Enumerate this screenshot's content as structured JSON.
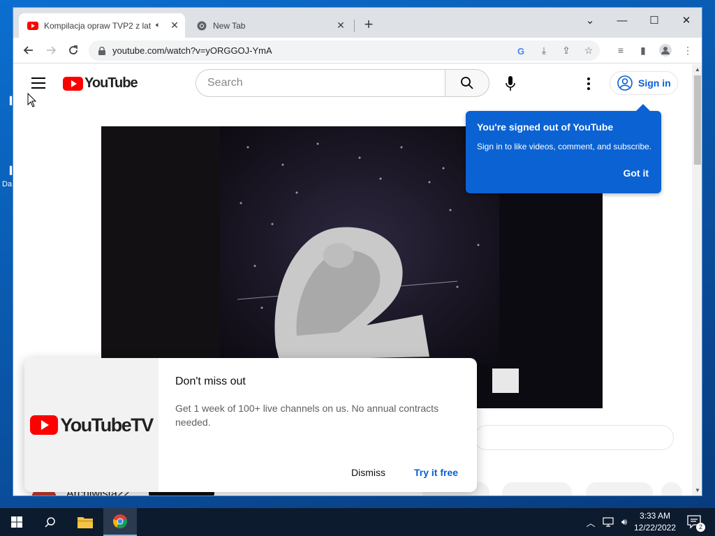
{
  "browser": {
    "tabs": [
      {
        "label": "Kompilacja opraw TVP2 z lat",
        "active": true
      },
      {
        "label": "New Tab",
        "active": false
      }
    ],
    "url": "youtube.com/watch?v=yORGGOJ-YmA"
  },
  "youtube": {
    "logo_text": "YouTube",
    "search_placeholder": "Search",
    "signin_label": "Sign in",
    "tooltip": {
      "title": "You're signed out of YouTube",
      "body": "Sign in to like videos, comment, and subscribe.",
      "button": "Got it"
    },
    "promo": {
      "logo_text": "YouTubeTV",
      "title": "Don't miss out",
      "body": "Get 1 week of 100+ live channels on us. No annual contracts needed.",
      "dismiss": "Dismiss",
      "try": "Try it free"
    },
    "channel": {
      "name": "Archiwista22"
    }
  },
  "desktop": {
    "frag_label": "Da"
  },
  "taskbar": {
    "time": "3:33 AM",
    "date": "12/22/2022",
    "notifications": "2"
  },
  "colors": {
    "yt_red": "#ff0000",
    "link_blue": "#065fd4",
    "tooltip_blue": "#0b62d3",
    "taskbar": "#0d1b2e"
  }
}
